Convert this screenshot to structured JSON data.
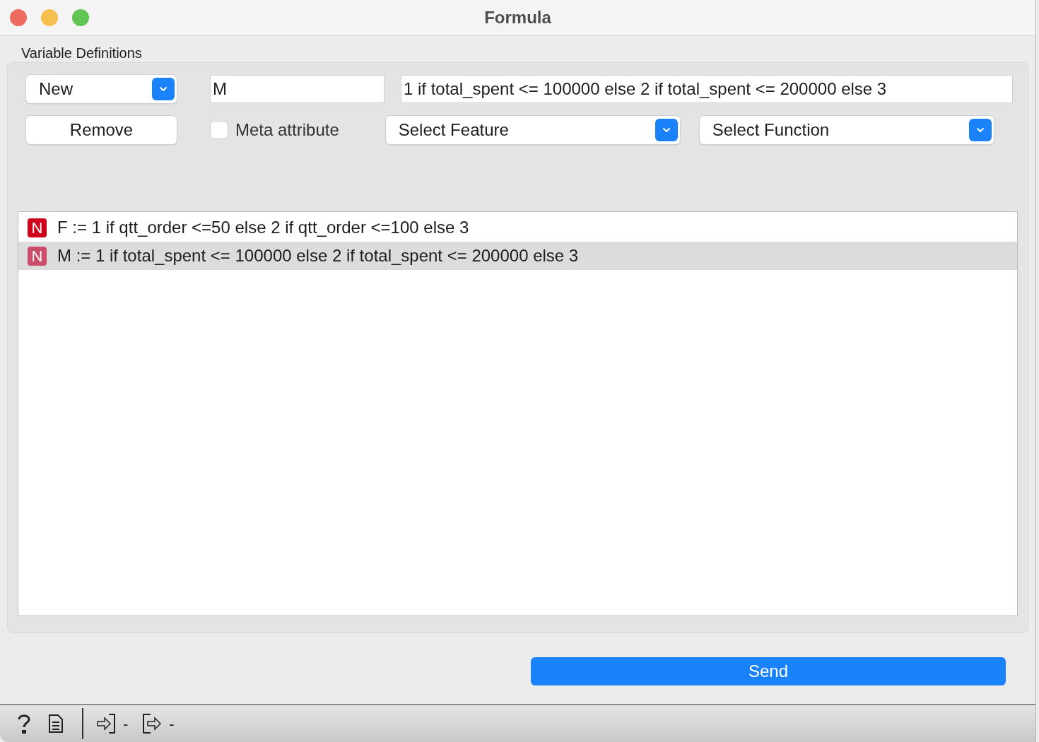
{
  "window": {
    "title": "Formula"
  },
  "group": {
    "title": "Variable Definitions"
  },
  "new_dropdown": {
    "value": "New"
  },
  "remove_button": {
    "label": "Remove"
  },
  "name_field": {
    "value": "M"
  },
  "expression_field": {
    "value": "1 if total_spent <= 100000 else 2 if total_spent <= 200000 else 3"
  },
  "meta_attribute": {
    "label": "Meta attribute",
    "checked": false
  },
  "feature_dropdown": {
    "value": "Select Feature"
  },
  "function_dropdown": {
    "value": "Select Function"
  },
  "definitions": [
    {
      "badge": "N",
      "text": "F := 1 if qtt_order <=50 else 2 if qtt_order <=100 else 3",
      "selected": false
    },
    {
      "badge": "N",
      "text": "M := 1 if total_spent <= 100000 else 2 if total_spent <= 200000 else 3",
      "selected": true
    }
  ],
  "send_button": {
    "label": "Send"
  },
  "status_bar": {
    "input_count": "-",
    "output_count": "-"
  }
}
